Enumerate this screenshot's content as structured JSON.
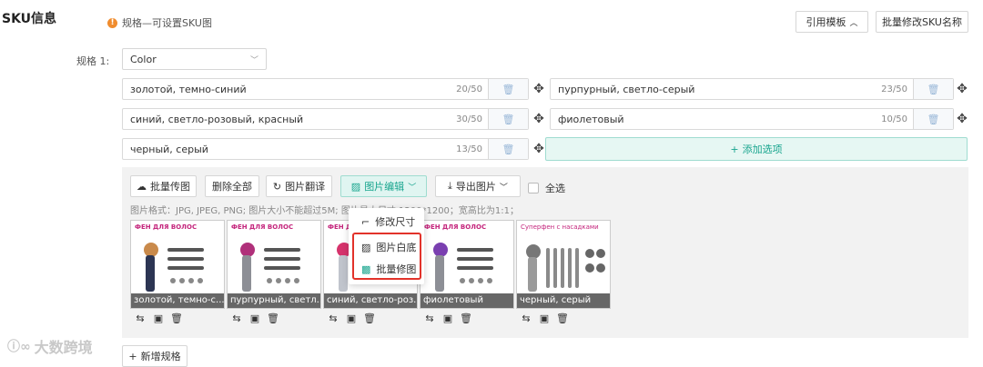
{
  "section": {
    "title": "SKU信息",
    "hint": "规格—可设置SKU图"
  },
  "header_buttons": {
    "template": "引用模板",
    "rename": "批量修改SKU名称"
  },
  "spec": {
    "label": "规格 1:",
    "selected": "Color"
  },
  "options": [
    {
      "text": "золотой, темно-синий",
      "count": "20/50"
    },
    {
      "text": "пурпурный, светло-серый",
      "count": "23/50"
    },
    {
      "text": "синий, светло-розовый, красный",
      "count": "30/50"
    },
    {
      "text": "фиолетовый",
      "count": "10/50"
    },
    {
      "text": "черный, серый",
      "count": "13/50"
    }
  ],
  "add_option": "添加选项",
  "toolbar": {
    "batch_upload": "批量传图",
    "delete_all": "删除全部",
    "translate": "图片翻译",
    "edit": "图片编辑",
    "export": "导出图片",
    "select_all": "全选"
  },
  "format_hint": "图片格式：JPG, JPEG, PNG; 图片大小不能超过5M; 图片最大尺寸 1200*1200；宽高比为1:1；",
  "images": [
    {
      "title": "ФЕН ДЛЯ ВОЛОС",
      "caption": "золотой, темно-с...",
      "accent": "#c98a4b",
      "body": "#2c3553"
    },
    {
      "title": "ФЕН ДЛЯ ВОЛОС",
      "caption": "пурпурный, светл...",
      "accent": "#b0307a",
      "body": "#8d8f96"
    },
    {
      "title": "ФЕН ДЛЯ ВОЛОС",
      "caption": "синий, светло-роз...",
      "accent": "#d6336c",
      "body": "#c0c4cc"
    },
    {
      "title": "ФЕН ДЛЯ ВОЛОС",
      "caption": "фиолетовый",
      "accent": "#7a3fb0",
      "body": "#8d8f96"
    },
    {
      "title": "Суперфен с насадками",
      "caption": "черный, серый",
      "accent": "#777777",
      "body": "#9a9a9a"
    }
  ],
  "dropdown": {
    "resize": "修改尺寸",
    "white_bg": "图片白底",
    "batch_retouch": "批量修图"
  },
  "add_spec": "新增规格",
  "watermark": "大数跨境",
  "colors": {
    "accent": "#18a58e",
    "highlight": "#e2322a",
    "warning": "#f08c2e"
  }
}
